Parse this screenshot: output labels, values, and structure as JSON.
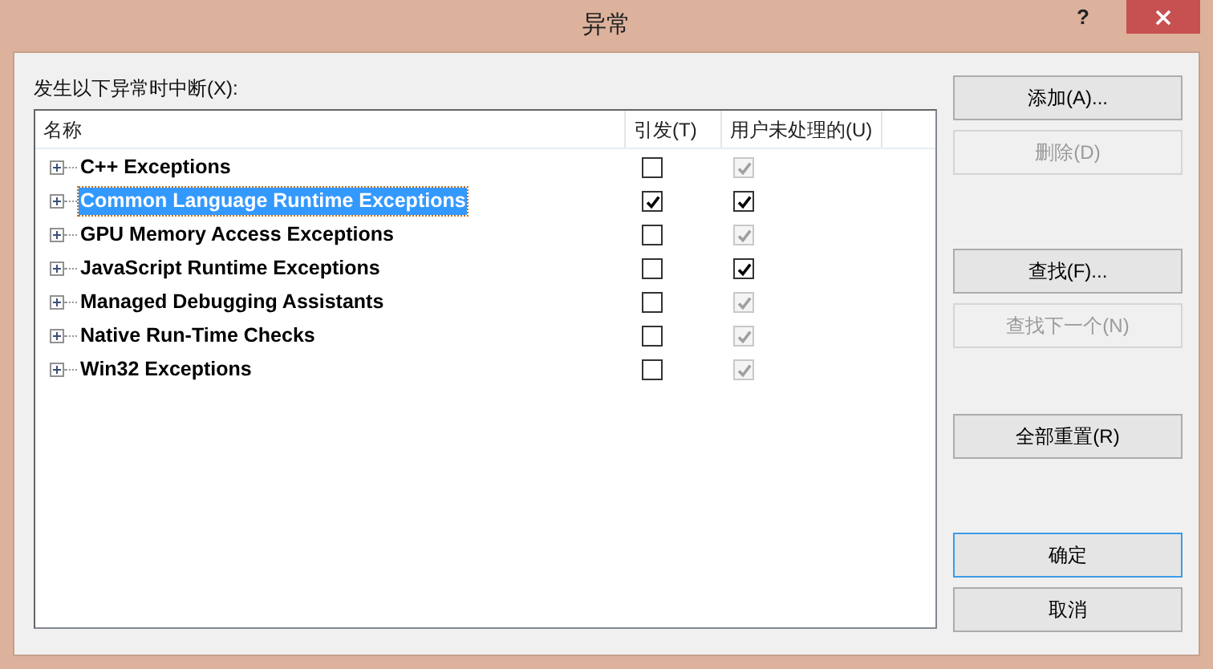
{
  "window": {
    "title": "异常",
    "help": "?"
  },
  "label": "发生以下异常时中断(X):",
  "table": {
    "columns": [
      "名称",
      "引发(T)",
      "用户未处理的(U)"
    ],
    "rows": [
      {
        "name": "C++ Exceptions",
        "selected": false,
        "thrown": {
          "checked": false
        },
        "unhandled": {
          "checked": true,
          "disabled": true
        }
      },
      {
        "name": "Common Language Runtime Exceptions",
        "selected": true,
        "thrown": {
          "checked": true
        },
        "unhandled": {
          "checked": true,
          "disabled": false
        }
      },
      {
        "name": "GPU Memory Access Exceptions",
        "selected": false,
        "thrown": {
          "checked": false
        },
        "unhandled": {
          "checked": true,
          "disabled": true
        }
      },
      {
        "name": "JavaScript Runtime Exceptions",
        "selected": false,
        "thrown": {
          "checked": false
        },
        "unhandled": {
          "checked": true,
          "disabled": false
        }
      },
      {
        "name": "Managed Debugging Assistants",
        "selected": false,
        "thrown": {
          "checked": false
        },
        "unhandled": {
          "checked": true,
          "disabled": true
        }
      },
      {
        "name": "Native Run-Time Checks",
        "selected": false,
        "thrown": {
          "checked": false
        },
        "unhandled": {
          "checked": true,
          "disabled": true
        }
      },
      {
        "name": "Win32 Exceptions",
        "selected": false,
        "thrown": {
          "checked": false
        },
        "unhandled": {
          "checked": true,
          "disabled": true
        }
      }
    ]
  },
  "button_groups": [
    [
      {
        "label": "添加(A)...",
        "disabled": false,
        "focused": false
      },
      {
        "label": "删除(D)",
        "disabled": true,
        "focused": false
      }
    ],
    [
      {
        "label": "查找(F)...",
        "disabled": false,
        "focused": false
      },
      {
        "label": "查找下一个(N)",
        "disabled": true,
        "focused": false
      }
    ],
    [
      {
        "label": "全部重置(R)",
        "disabled": false,
        "focused": false
      }
    ],
    [
      {
        "label": "确定",
        "disabled": false,
        "focused": true
      },
      {
        "label": "取消",
        "disabled": false,
        "focused": false
      }
    ]
  ]
}
